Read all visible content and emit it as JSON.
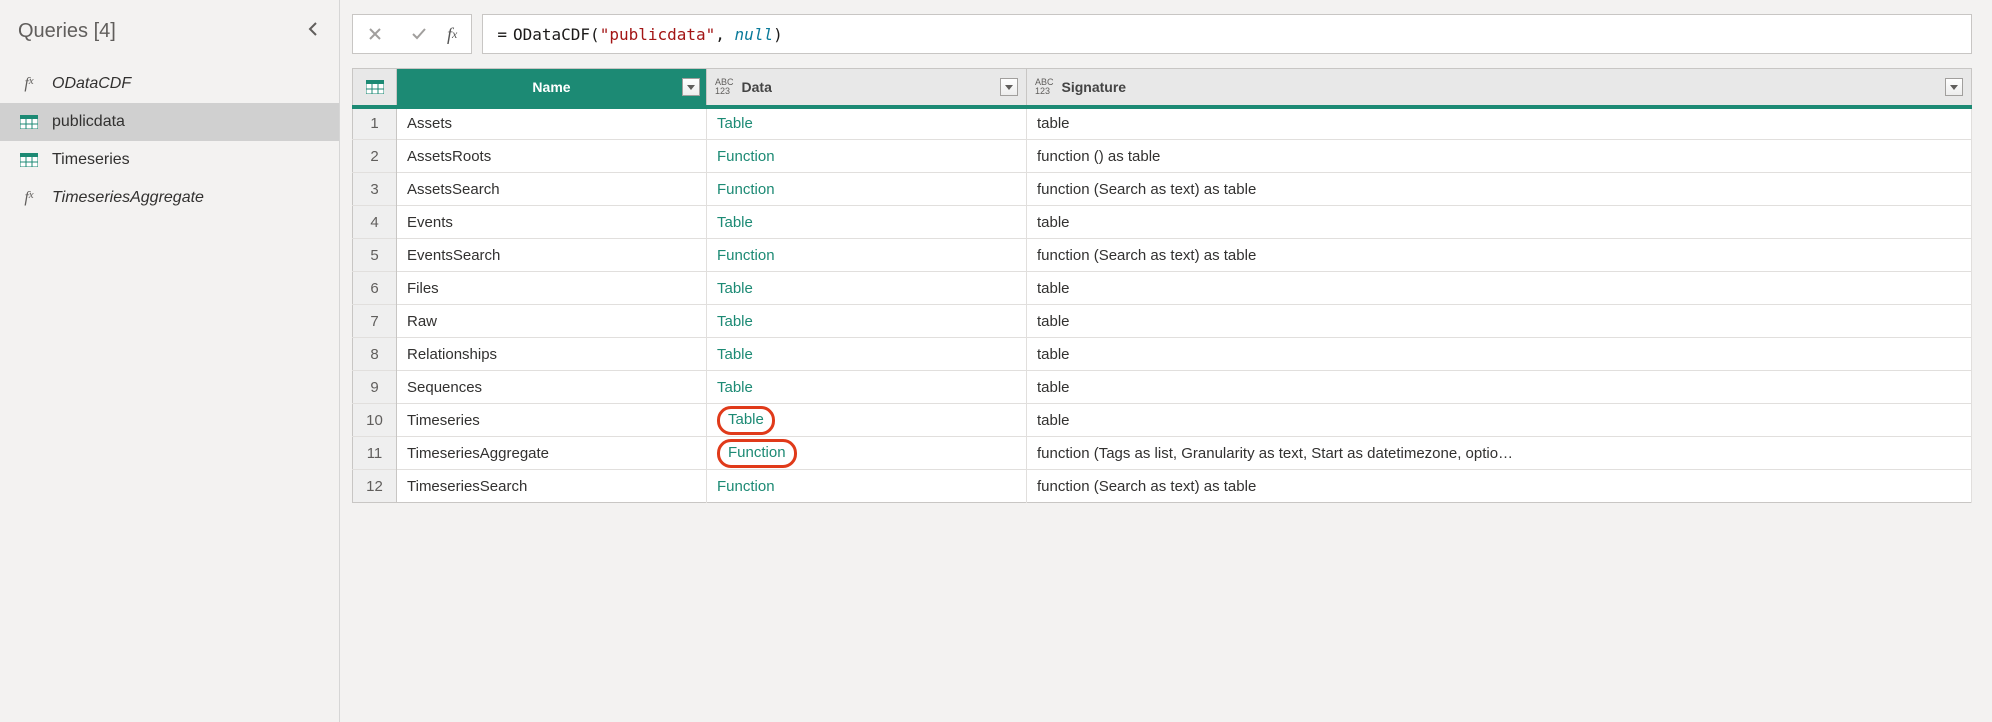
{
  "sidebar": {
    "title": "Queries [4]",
    "items": [
      {
        "icon": "fx",
        "label": "ODataCDF",
        "italic": true
      },
      {
        "icon": "table",
        "label": "publicdata",
        "selected": true
      },
      {
        "icon": "table",
        "label": "Timeseries"
      },
      {
        "icon": "fx",
        "label": "TimeseriesAggregate",
        "italic": true
      }
    ]
  },
  "formula": {
    "fn": "ODataCDF",
    "argstr": "\"publicdata\"",
    "nullkw": "null"
  },
  "columns": {
    "name": "Name",
    "data": "Data",
    "signature": "Signature"
  },
  "rows": [
    {
      "n": 1,
      "name": "Assets",
      "data": "Table",
      "sig": "table"
    },
    {
      "n": 2,
      "name": "AssetsRoots",
      "data": "Function",
      "sig": "function () as table"
    },
    {
      "n": 3,
      "name": "AssetsSearch",
      "data": "Function",
      "sig": "function (Search as text) as table"
    },
    {
      "n": 4,
      "name": "Events",
      "data": "Table",
      "sig": "table"
    },
    {
      "n": 5,
      "name": "EventsSearch",
      "data": "Function",
      "sig": "function (Search as text) as table"
    },
    {
      "n": 6,
      "name": "Files",
      "data": "Table",
      "sig": "table"
    },
    {
      "n": 7,
      "name": "Raw",
      "data": "Table",
      "sig": "table"
    },
    {
      "n": 8,
      "name": "Relationships",
      "data": "Table",
      "sig": "table"
    },
    {
      "n": 9,
      "name": "Sequences",
      "data": "Table",
      "sig": "table"
    },
    {
      "n": 10,
      "name": "Timeseries",
      "data": "Table",
      "sig": "table",
      "circled": true
    },
    {
      "n": 11,
      "name": "TimeseriesAggregate",
      "data": "Function",
      "sig": "function (Tags as list, Granularity as text, Start as datetimezone, optio…",
      "circled": true
    },
    {
      "n": 12,
      "name": "TimeseriesSearch",
      "data": "Function",
      "sig": "function (Search as text) as table"
    }
  ]
}
